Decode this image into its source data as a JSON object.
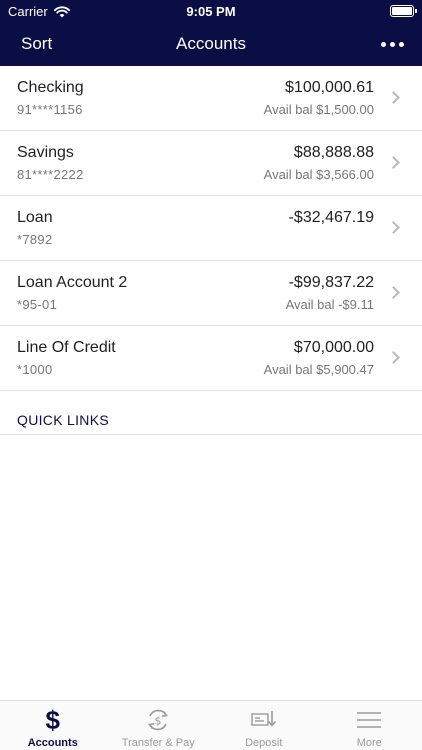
{
  "status": {
    "carrier": "Carrier",
    "time": "9:05 PM"
  },
  "nav": {
    "sort_label": "Sort",
    "title": "Accounts"
  },
  "accounts": [
    {
      "name": "Checking",
      "number": "91****1156",
      "balance": "$100,000.61",
      "avail": "Avail bal $1,500.00"
    },
    {
      "name": "Savings",
      "number": "81****2222",
      "balance": "$88,888.88",
      "avail": "Avail bal $3,566.00"
    },
    {
      "name": "Loan",
      "number": "*7892",
      "balance": "-$32,467.19",
      "avail": ""
    },
    {
      "name": "Loan Account 2",
      "number": "*95-01",
      "balance": "-$99,837.22",
      "avail": "Avail bal -$9.11"
    },
    {
      "name": "Line Of Credit",
      "number": "*1000",
      "balance": "$70,000.00",
      "avail": "Avail bal $5,900.47"
    }
  ],
  "quick_links": {
    "title": "QUICK LINKS"
  },
  "tabbar": {
    "tabs": [
      {
        "label": "Accounts",
        "icon": "dollar-icon",
        "active": true
      },
      {
        "label": "Transfer & Pay",
        "icon": "transfer-icon",
        "active": false
      },
      {
        "label": "Deposit",
        "icon": "deposit-check-icon",
        "active": false
      },
      {
        "label": "More",
        "icon": "menu-icon",
        "active": false
      }
    ],
    "dollar_glyph": "$"
  },
  "colors": {
    "brand": "#0b0e45",
    "muted": "#777777",
    "tab_inactive": "#9a9a9a"
  }
}
